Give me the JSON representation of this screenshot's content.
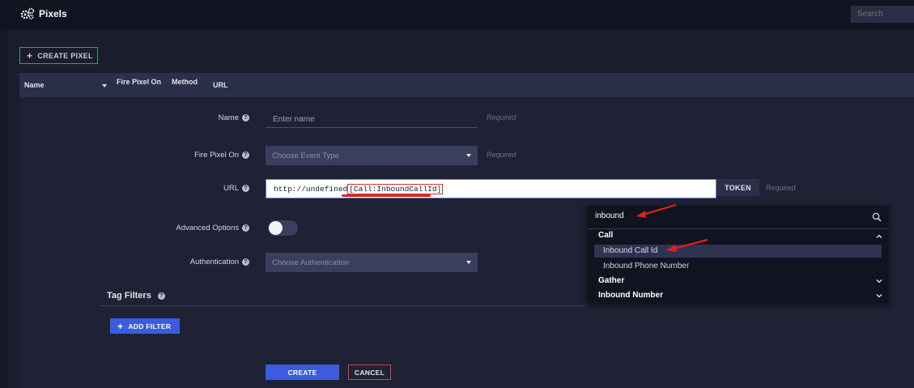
{
  "app": {
    "title": "Pixels",
    "icon": "gears-icon"
  },
  "search": {
    "placeholder": "Search"
  },
  "toolbar": {
    "create_pixel_label": "CREATE PIXEL"
  },
  "table": {
    "columns": [
      "Name",
      "Fire Pixel On",
      "Method",
      "URL"
    ]
  },
  "form": {
    "name": {
      "label": "Name",
      "placeholder": "Enter name",
      "required": "Required"
    },
    "fire_pixel_on": {
      "label": "Fire Pixel On",
      "placeholder": "Choose Event Type",
      "required": "Required"
    },
    "url": {
      "label": "URL",
      "value_prefix": "http://undefined",
      "value_token": "[Call:InboundCallId]",
      "token_button": "TOKEN",
      "required": "Required"
    },
    "advanced_options": {
      "label": "Advanced Options",
      "enabled": false
    },
    "authentication": {
      "label": "Authentication",
      "placeholder": "Choose Authentication"
    },
    "tag_filters": {
      "title": "Tag Filters",
      "add_filter_label": "ADD FILTER"
    },
    "create_label": "CREATE",
    "cancel_label": "CANCEL"
  },
  "token_dropdown": {
    "search_value": "inbound",
    "groups": [
      {
        "name": "Call",
        "expanded": true,
        "items": [
          "Inbound Call Id",
          "Inbound Phone Number"
        ]
      },
      {
        "name": "Gather",
        "expanded": false,
        "items": []
      },
      {
        "name": "Inbound Number",
        "expanded": false,
        "items": []
      }
    ],
    "highlighted_item": "Inbound Call Id"
  },
  "colors": {
    "accent_blue": "#3b5be0",
    "create_pixel_border": "#3e9b63",
    "cancel_border": "#d04545",
    "annotation_red": "#e02020"
  }
}
